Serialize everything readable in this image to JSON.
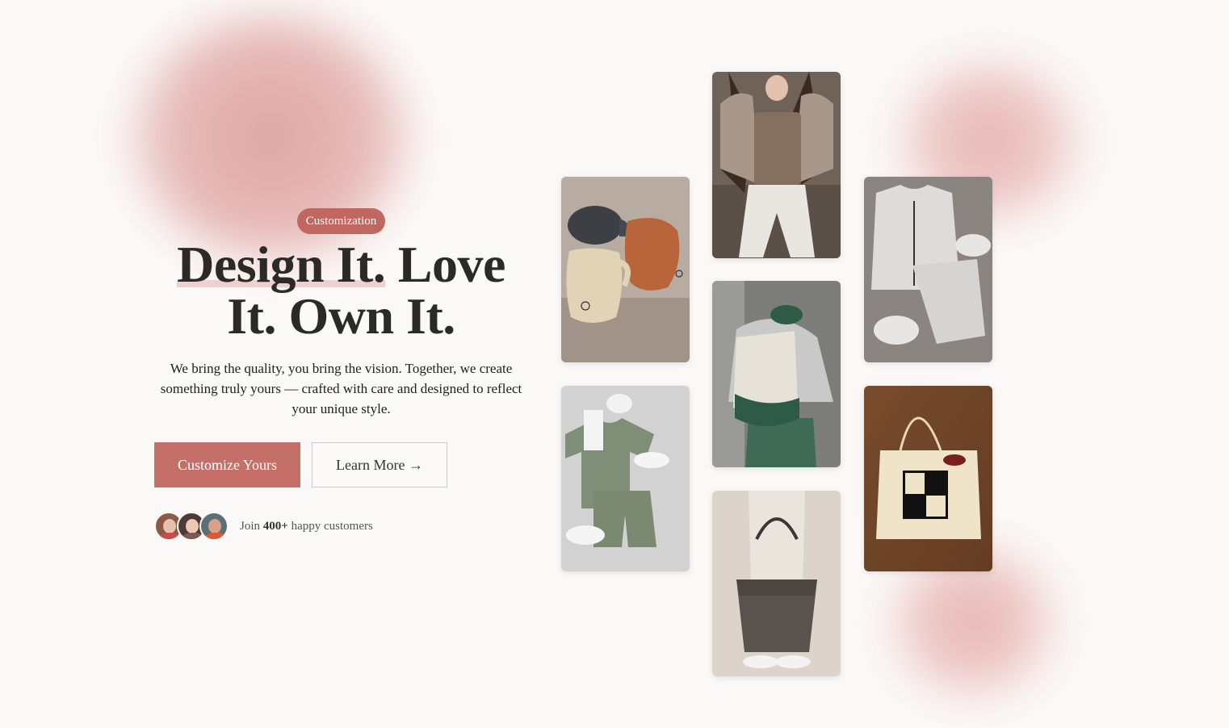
{
  "hero": {
    "badge": "Customization",
    "headline_part1": "Design It.",
    "headline_part2": " Love It. Own It.",
    "subtext": "We bring the quality, you bring the vision. Together, we create something truly yours — crafted with care and designed to reflect your unique style.",
    "primary_button": "Customize Yours",
    "secondary_button": "Learn More →",
    "social_prefix": "Join ",
    "social_count": "400+",
    "social_suffix": " happy customers"
  },
  "colors": {
    "accent": "#c46f68",
    "badge": "#c0675f",
    "background": "#fbf9f8",
    "text": "#2b2a27"
  },
  "gallery": [
    {
      "name": "mugs",
      "alt": "Ceramic mugs"
    },
    {
      "name": "tank-outfit",
      "alt": "Flannel and tank outfit"
    },
    {
      "name": "puffer-vest-set",
      "alt": "Puffer vest set"
    },
    {
      "name": "green-tee-set",
      "alt": "Green tee set"
    },
    {
      "name": "tote-outfit",
      "alt": "Tote bag outfit"
    },
    {
      "name": "canvas-tote",
      "alt": "Canvas tote bag"
    },
    {
      "name": "brown-tote",
      "alt": "Brown tote bag"
    }
  ]
}
